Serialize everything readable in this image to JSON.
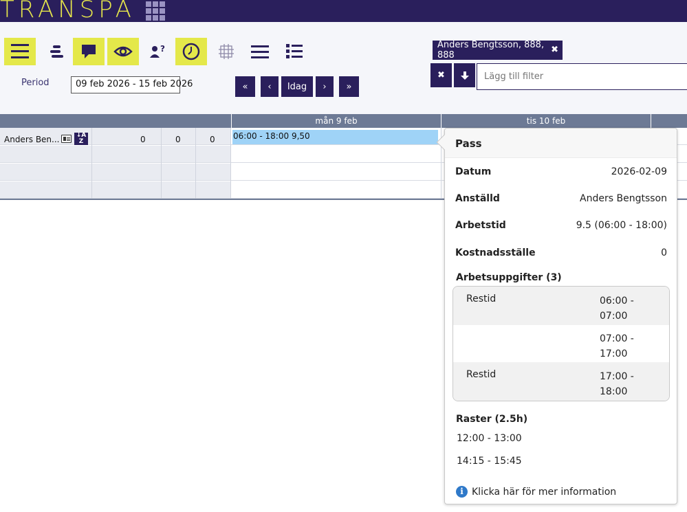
{
  "brand": {
    "logo_text": "TRANSPA"
  },
  "toolbar": {
    "icons": [
      "menu-icon",
      "gantt-icon",
      "comment-icon",
      "eye-icon",
      "user-question-icon",
      "clock-icon",
      "grid-frame-icon",
      "lines-icon",
      "list-icon"
    ],
    "highlighted": [
      "menu-icon",
      "comment-icon",
      "eye-icon",
      "clock-icon"
    ],
    "highlight_color": "#e4e84a"
  },
  "period": {
    "label": "Period",
    "value": "09 feb 2026 - 15 feb 2026"
  },
  "navigation": {
    "first": "«",
    "prev": "‹",
    "today": "Idag",
    "next": "›",
    "last": "»"
  },
  "filter": {
    "chip_label": "Anders Bengtsson, 888, 888",
    "chip_remove": "✖",
    "clear_label": "✖",
    "down_label": "🡇",
    "placeholder": "Lägg till filter"
  },
  "grid": {
    "days": [
      "mån 9 feb",
      "tis 10 feb"
    ],
    "employee": {
      "name": "Anders Ben...",
      "sort_label": "A Z",
      "values": [
        "0",
        "0",
        "0"
      ]
    },
    "shift_label": "06:00 - 18:00 9,50"
  },
  "popover": {
    "title": "Pass",
    "fields": [
      {
        "label": "Datum",
        "value": "2026-02-09"
      },
      {
        "label": "Anställd",
        "value": "Anders Bengtsson"
      },
      {
        "label": "Arbetstid",
        "value": "9.5 (06:00 - 18:00)"
      },
      {
        "label": "Kostnadsställe",
        "value": "0"
      }
    ],
    "tasks_title": "Arbetsuppgifter  (3)",
    "tasks": [
      {
        "name": "Restid",
        "time": "06:00 - 07:00"
      },
      {
        "name": "",
        "time": "07:00 - 17:00"
      },
      {
        "name": "Restid",
        "time": "17:00 - 18:00"
      }
    ],
    "breaks_title": "Raster  (2.5h)",
    "breaks": [
      "12:00 - 13:00",
      "14:15 - 15:45"
    ],
    "info_link": "Klicka här för mer information"
  },
  "colors": {
    "primary": "#2a1f5c",
    "accent": "#e4e84a",
    "shift": "#9fd3f7",
    "grid_header": "#6d7a95",
    "info": "#2f79c9"
  }
}
